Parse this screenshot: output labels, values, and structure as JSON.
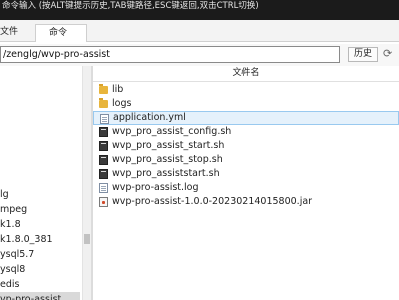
{
  "hint_bar": {
    "text": "命令输入 (按ALT键提示历史,TAB键路径,ESC键返回,双击CTRL切换)"
  },
  "tabs": [
    {
      "label": "文件"
    },
    {
      "label": "命令"
    }
  ],
  "path_bar": {
    "value": "/zenglg/wvp-pro-assist",
    "history_label": "历史"
  },
  "left_tree": [
    {
      "label": "lg"
    },
    {
      "label": "mpeg"
    },
    {
      "label": "k1.8"
    },
    {
      "label": "k1.8.0_381"
    },
    {
      "label": "ysql5.7"
    },
    {
      "label": "ysql8"
    },
    {
      "label": "edis"
    },
    {
      "label": "vp-pro-assist"
    }
  ],
  "file_list": {
    "column_header": "文件名",
    "files": [
      {
        "name": "lib",
        "icon": "folder-icon"
      },
      {
        "name": "logs",
        "icon": "folder-icon"
      },
      {
        "name": "application.yml",
        "icon": "document-icon"
      },
      {
        "name": "wvp_pro_assist_config.sh",
        "icon": "script-icon"
      },
      {
        "name": "wvp_pro_assist_start.sh",
        "icon": "script-icon"
      },
      {
        "name": "wvp_pro_assist_stop.sh",
        "icon": "script-icon"
      },
      {
        "name": "wvp_pro_assiststart.sh",
        "icon": "script-icon"
      },
      {
        "name": "wvp-pro-assist.log",
        "icon": "document-icon"
      },
      {
        "name": "wvp-pro-assist-1.0.0-20230214015800.jar",
        "icon": "jar-icon"
      }
    ]
  }
}
